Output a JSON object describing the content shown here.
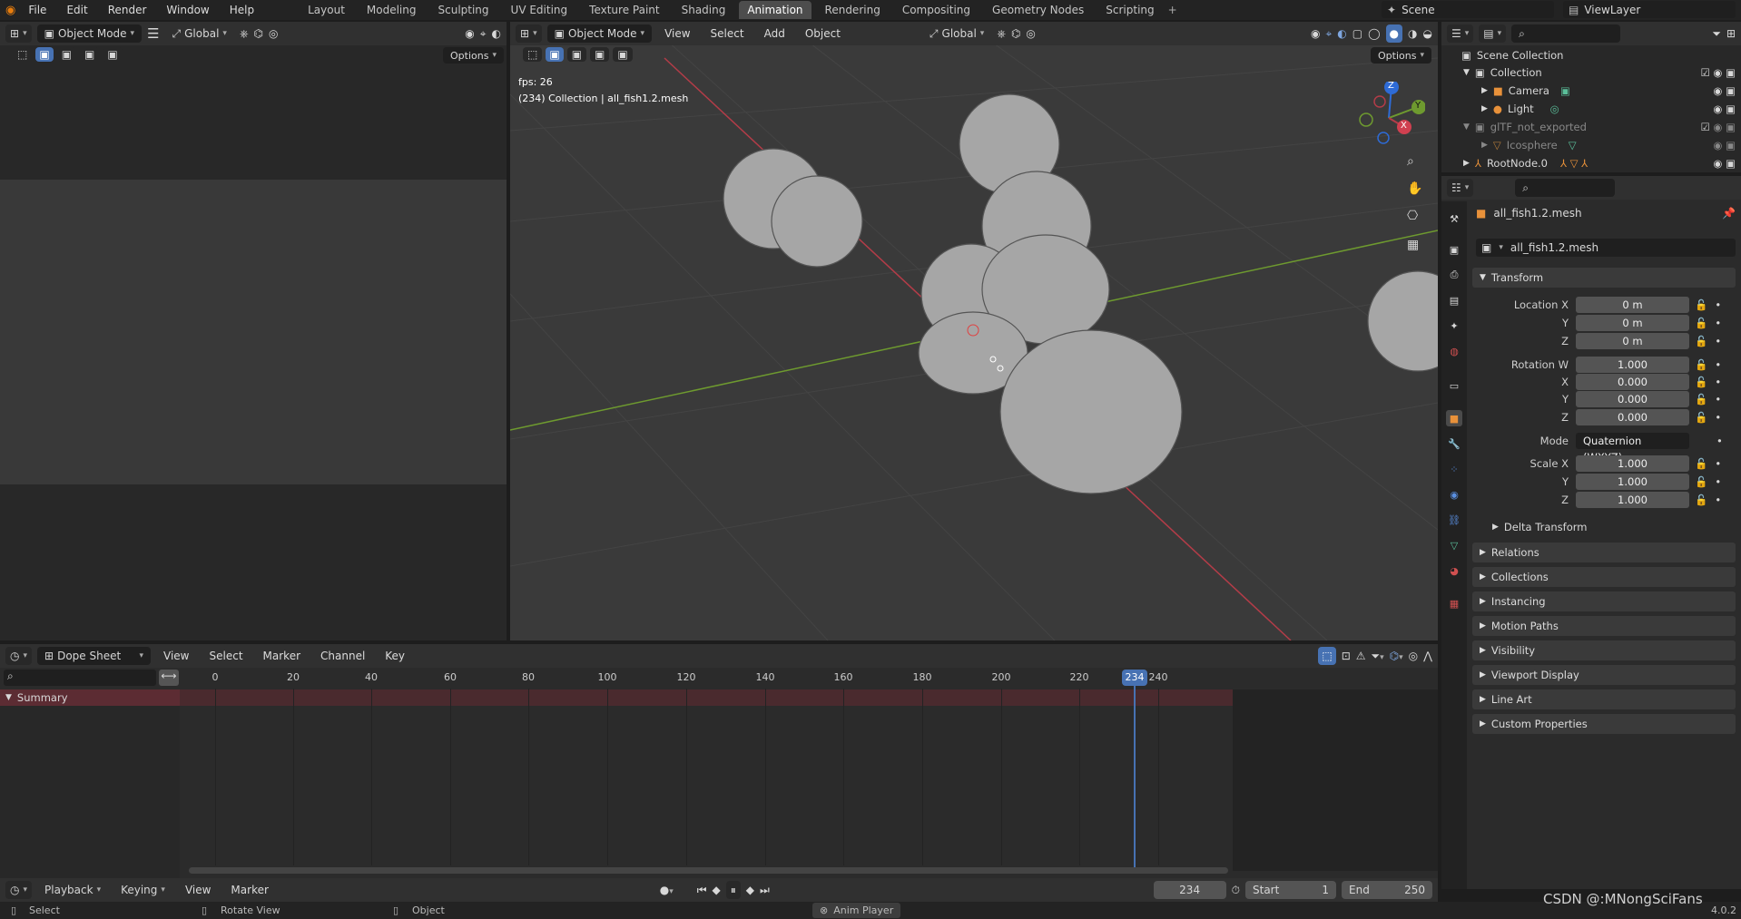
{
  "topbar": {
    "menus": [
      "File",
      "Edit",
      "Render",
      "Window",
      "Help"
    ],
    "workspaces": [
      "Layout",
      "Modeling",
      "Sculpting",
      "UV Editing",
      "Texture Paint",
      "Shading",
      "Animation",
      "Rendering",
      "Compositing",
      "Geometry Nodes",
      "Scripting"
    ],
    "active_workspace": "Animation",
    "scene": "Scene",
    "view_layer": "ViewLayer"
  },
  "left_editor": {
    "mode": "Object Mode",
    "orientation": "Global",
    "options": "Options"
  },
  "viewport": {
    "mode": "Object Mode",
    "menus": [
      "View",
      "Select",
      "Add",
      "Object"
    ],
    "orientation": "Global",
    "options": "Options",
    "fps": "fps: 26",
    "info": "(234) Collection | all_fish1.2.mesh",
    "gizmo": {
      "z": "Z",
      "y": "Y",
      "x": "X"
    }
  },
  "outliner": {
    "items": [
      {
        "label": "Scene Collection"
      },
      {
        "label": "Collection"
      },
      {
        "label": "Camera"
      },
      {
        "label": "Light"
      },
      {
        "label": "glTF_not_exported"
      },
      {
        "label": "Icosphere"
      },
      {
        "label": "RootNode.0"
      }
    ]
  },
  "properties": {
    "object_name": "all_fish1.2.mesh",
    "data_name": "all_fish1.2.mesh",
    "transform_label": "Transform",
    "location": {
      "label": "Location X",
      "x": "0 m",
      "y": "0 m",
      "z": "0 m"
    },
    "rotation": {
      "label": "Rotation W",
      "w": "1.000",
      "x": "0.000",
      "y": "0.000",
      "z": "0.000"
    },
    "mode_label": "Mode",
    "mode_value": "Quaternion (WXYZ)",
    "scale": {
      "label": "Scale X",
      "x": "1.000",
      "y": "1.000",
      "z": "1.000"
    },
    "axis_labels": {
      "x": "X",
      "y": "Y",
      "z": "Z"
    },
    "delta": "Delta Transform",
    "panels": [
      "Relations",
      "Collections",
      "Instancing",
      "Motion Paths",
      "Visibility",
      "Viewport Display",
      "Line Art",
      "Custom Properties"
    ]
  },
  "dopesheet": {
    "editor": "Dope Sheet",
    "menus": [
      "View",
      "Select",
      "Marker",
      "Channel",
      "Key"
    ],
    "summary": "Summary",
    "ticks": [
      "0",
      "20",
      "40",
      "60",
      "80",
      "100",
      "120",
      "140",
      "160",
      "180",
      "200",
      "220",
      "240"
    ],
    "current_frame": "234"
  },
  "timeline": {
    "menus": [
      "Playback",
      "Keying",
      "View",
      "Marker"
    ],
    "frame": "234",
    "start_label": "Start",
    "start": "1",
    "end_label": "End",
    "end": "250"
  },
  "statusbar": {
    "select": "Select",
    "rotate": "Rotate View",
    "object": "Object",
    "anim_player": "Anim Player",
    "version": "4.0.2",
    "watermark": "CSDN @:MNongSciFans"
  },
  "colors": {
    "accent": "#4772b3",
    "header": "#303030",
    "panel": "#3d3d3d",
    "grid_red": "#b33c48",
    "grid_green": "#6e9a2f"
  }
}
